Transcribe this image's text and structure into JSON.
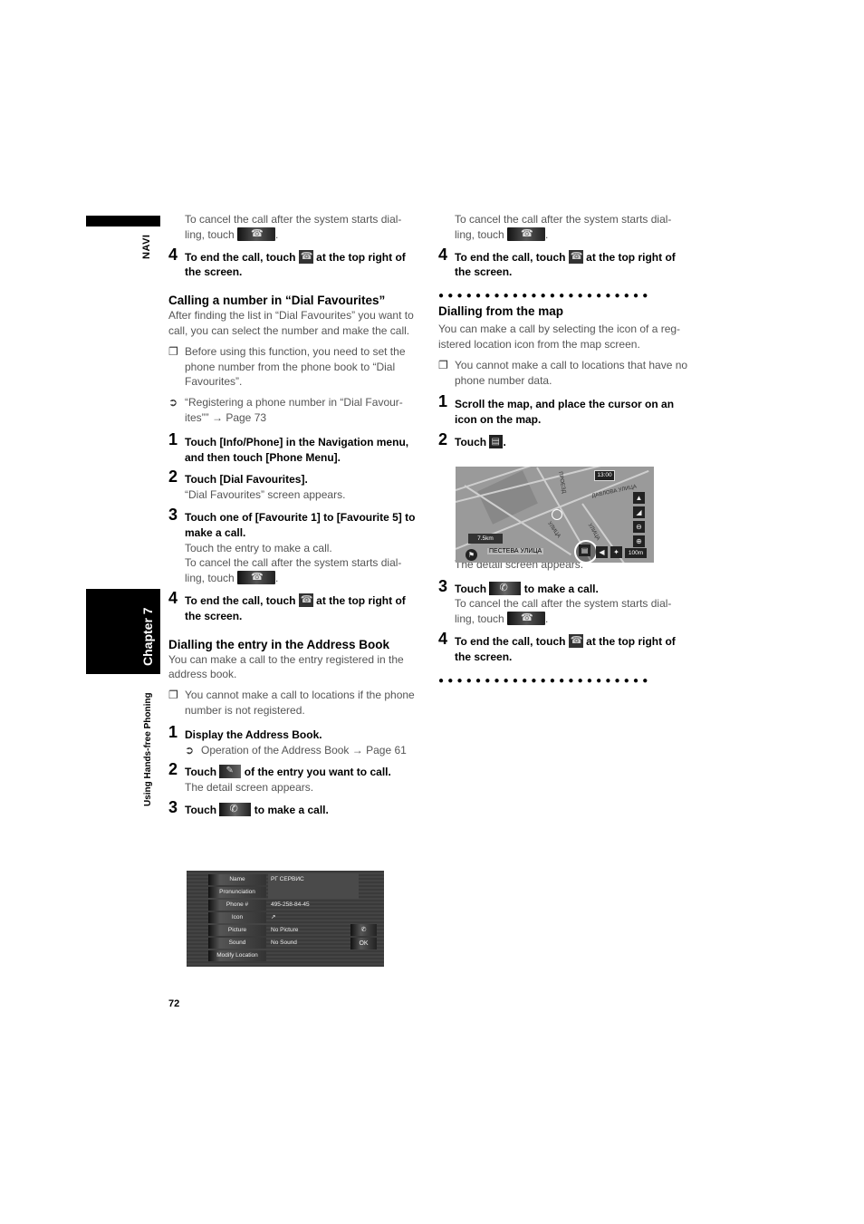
{
  "side": {
    "navi_label": "NAVI",
    "chapter_label": "Chapter 7",
    "section_label": "Using Hands-free Phoning"
  },
  "left_column": {
    "intro_cancel": "To cancel the call after the system starts dial-ling, touch",
    "intro_cancel_line1": "To cancel the call after the system starts dial-",
    "intro_cancel_line2": "ling, touch",
    "step4": {
      "num": "4",
      "text_before": "To end the call, touch",
      "text_after": "at the top right of the screen."
    },
    "fav_section": {
      "heading": "Calling a number in “Dial Favourites”",
      "intro": "After finding the list in “Dial Favourites” you want to call, you can select the number and make the call.",
      "note": "Before using this function, you need to set the phone number from the phone book to “Dial Favourites”.",
      "ref": "“Registering a phone number in “Dial Favour-ites”” → Page 73",
      "steps": [
        {
          "num": "1",
          "title": "Touch [Info/Phone] in the Navigation menu, and then touch [Phone Menu]."
        },
        {
          "num": "2",
          "title": "Touch [Dial Favourites].",
          "desc": "“Dial Favourites” screen appears."
        },
        {
          "num": "3",
          "title": "Touch one of [Favourite 1] to [Favourite 5] to make a call.",
          "desc": "Touch the entry to make a call.",
          "cancel_line1": "To cancel the call after the system starts dial-",
          "cancel_line2": "ling, touch"
        },
        {
          "num": "4",
          "text_before": "To end the call, touch",
          "text_after": "at the top right of the screen."
        }
      ]
    },
    "addr_section": {
      "heading": "Dialling the entry in the Address Book",
      "intro": "You can make a call to the entry registered in the address book.",
      "note": "You cannot make a call to locations if the phone number is not registered.",
      "steps": [
        {
          "num": "1",
          "title": "Display the Address Book.",
          "ref": "Operation of the Address Book → Page 61"
        },
        {
          "num": "2",
          "text_before": "Touch",
          "text_after": "of the entry you want to call.",
          "desc": "The detail screen appears."
        },
        {
          "num": "3",
          "text_before": "Touch",
          "text_after": "to make a call."
        }
      ]
    },
    "address_screen": {
      "rows": [
        {
          "label": "Name",
          "value": "РГ СЕРВИС"
        },
        {
          "label": "Pronunciation",
          "value": ""
        },
        {
          "label": "Phone #",
          "value": "495-258-84-45"
        },
        {
          "label": "Icon",
          "value": "↗"
        },
        {
          "label": "Picture",
          "value": "No Picture"
        },
        {
          "label": "Sound",
          "value": "No Sound"
        },
        {
          "label": "Modify Location",
          "value": ""
        }
      ],
      "call_button": "✆",
      "ok_button": "OK"
    }
  },
  "right_column": {
    "cancel_line1": "To cancel the call after the system starts dial-",
    "cancel_line2": "ling, touch",
    "step4": {
      "num": "4",
      "text_before": "To end the call, touch",
      "text_after": "at the top right of the screen."
    },
    "dots": "●●●●●●●●●●●●●●●●●●●●●●●",
    "map_section": {
      "heading": "Dialling from the map",
      "intro": "You can make a call by selecting the icon of a reg-istered location icon from the map screen.",
      "note": "You cannot make a call to locations that have no phone number data.",
      "steps": [
        {
          "num": "1",
          "title": "Scroll the map, and place the cursor on an icon on the map."
        },
        {
          "num": "2",
          "text_before": "Touch",
          "text_after": "."
        },
        {
          "num": "3",
          "text_before": "Touch",
          "text_after": "to make a call.",
          "cancel_line1": "To cancel the call after the system starts dial-",
          "cancel_line2": "ling, touch"
        },
        {
          "num": "4",
          "text_before": "To end the call, touch",
          "text_after": "at the top right of the screen."
        }
      ],
      "map_caption": "The detail screen appears."
    },
    "map_screen": {
      "time": "13:00",
      "distance": "7.5km",
      "current_street": "ПЕСТЕВА УЛИЦА",
      "scale": "100m",
      "streets": [
        "ДАВЛОВА УЛИЦА",
        "УЛИЦА",
        "ПРОЕЗД",
        "УЛИЦА"
      ]
    }
  },
  "page_number": "72"
}
